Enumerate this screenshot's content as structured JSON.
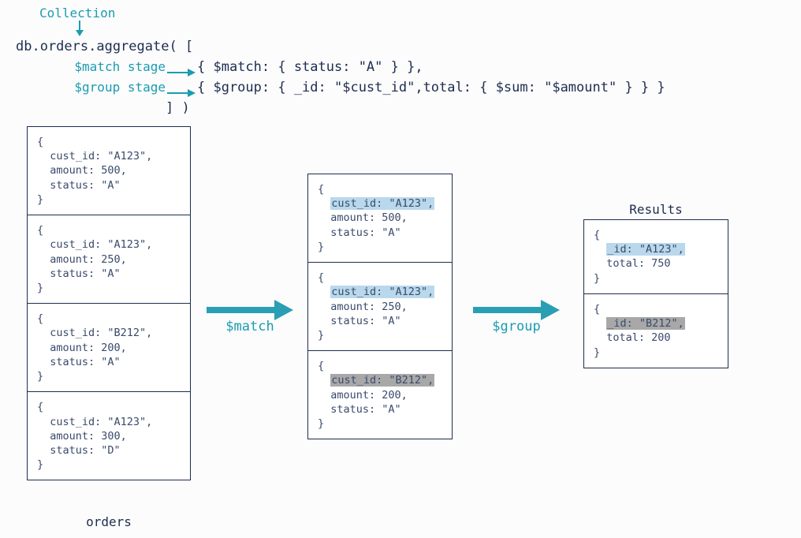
{
  "header": {
    "collection_label": "Collection",
    "code_line1": "db.orders.aggregate( [",
    "code_line2": "{ $match: { status: \"A\" } },",
    "code_line3": "{ $group: { _id: \"$cust_id\",total: { $sum: \"$amount\" } } }",
    "code_line4": "] )",
    "match_stage_label": "$match stage",
    "group_stage_label": "$group stage"
  },
  "arrows": {
    "match_label": "$match",
    "group_label": "$group"
  },
  "orders": {
    "title": "orders",
    "docs": [
      {
        "line1": "{",
        "line2": "  cust_id: \"A123\",",
        "line3": "  amount: 500,",
        "line4": "  status: \"A\"",
        "line5": "}"
      },
      {
        "line1": "{",
        "line2": "  cust_id: \"A123\",",
        "line3": "  amount: 250,",
        "line4": "  status: \"A\"",
        "line5": "}"
      },
      {
        "line1": "{",
        "line2": "  cust_id: \"B212\",",
        "line3": "  amount: 200,",
        "line4": "  status: \"A\"",
        "line5": "}"
      },
      {
        "line1": "{",
        "line2": "  cust_id: \"A123\",",
        "line3": "  amount: 300,",
        "line4": "  status: \"D\"",
        "line5": "}"
      }
    ]
  },
  "matched": {
    "docs": [
      {
        "line1": "{",
        "hl": "cust_id: \"A123\",",
        "hl_class": "hl-blue",
        "line3": "  amount: 500,",
        "line4": "  status: \"A\"",
        "line5": "}"
      },
      {
        "line1": "{",
        "hl": "cust_id: \"A123\",",
        "hl_class": "hl-blue",
        "line3": "  amount: 250,",
        "line4": "  status: \"A\"",
        "line5": "}"
      },
      {
        "line1": "{",
        "hl": "cust_id: \"B212\",",
        "hl_class": "hl-gray",
        "line3": "  amount: 200,",
        "line4": "  status: \"A\"",
        "line5": "}"
      }
    ]
  },
  "results": {
    "title": "Results",
    "docs": [
      {
        "line1": "{",
        "hl": "_id: \"A123\",",
        "hl_class": "hl-blue",
        "line3": "  total: 750",
        "line4": "}"
      },
      {
        "line1": "{",
        "hl": "_id: \"B212\",",
        "hl_class": "hl-gray",
        "line3": "  total: 200",
        "line4": "}"
      }
    ]
  }
}
